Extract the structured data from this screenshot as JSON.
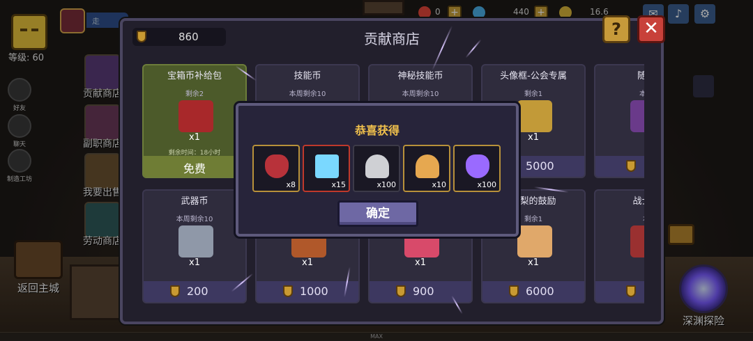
{
  "player": {
    "level_label": "等级: 60",
    "top_pill": "走"
  },
  "resources": [
    {
      "value": "0",
      "color": "#e2453a"
    },
    {
      "value": "440",
      "color": "#4ab0e8"
    },
    {
      "value": "16.6",
      "color": "#d8b43a"
    }
  ],
  "social": [
    {
      "label": "好友",
      "icon": "friends-icon"
    },
    {
      "label": "聊天",
      "icon": "chat-icon"
    },
    {
      "label": "制造工坊",
      "icon": "workshop-icon"
    }
  ],
  "side_tabs": [
    {
      "label": "贡献商店",
      "color": "#5a3b78"
    },
    {
      "label": "副职商店",
      "color": "#6b3a5a"
    },
    {
      "label": "我要出售",
      "color": "#6b5230"
    },
    {
      "label": "劳动商店",
      "color": "#2f5a5a"
    }
  ],
  "return_label": "返回主城",
  "abyss_label": "深渊探险",
  "bottom_label": "MAX",
  "shop": {
    "title": "贡献商店",
    "coin_value": "860",
    "help_label": "?",
    "close_label": "✕",
    "cards_row1": [
      {
        "name": "宝箱币补给包",
        "sub": "剩余2",
        "qty": "x1",
        "timer": "剩余时间：18小时",
        "price": "免费",
        "free": true,
        "item_color": "#a8282a"
      },
      {
        "name": "技能币",
        "sub": "本周剩余10",
        "qty": "",
        "timer": "",
        "price": "",
        "free": false,
        "item_color": "#4a4860"
      },
      {
        "name": "神秘技能币",
        "sub": "本周剩余10",
        "qty": "",
        "timer": "",
        "price": "",
        "free": false,
        "item_color": "#4a4860"
      },
      {
        "name": "头像框-公会专属",
        "sub": "剩余1",
        "qty": "x1",
        "timer": "",
        "price": "5000",
        "free": false,
        "item_color": "#c29a38"
      },
      {
        "name": "随机",
        "sub": "本周",
        "qty": "",
        "timer": "",
        "price": "",
        "free": false,
        "item_color": "#6a3a8a"
      }
    ],
    "cards_row2": [
      {
        "name": "武器币",
        "sub": "本周剩余10",
        "qty": "x1",
        "price": "200",
        "item_color": "#8f98a8"
      },
      {
        "name": "",
        "sub": "",
        "qty": "x1",
        "price": "1000",
        "item_color": "#b0582a"
      },
      {
        "name": "",
        "sub": "",
        "qty": "x1",
        "price": "900",
        "item_color": "#d84a6a"
      },
      {
        "name": "梨梨的鼓励",
        "sub": "剩余1",
        "qty": "x1",
        "price": "6000",
        "item_color": "#e0a86a"
      },
      {
        "name": "战士天",
        "sub": "本",
        "qty": "",
        "price": "",
        "item_color": "#9a3030"
      }
    ]
  },
  "popup": {
    "title": "恭喜获得",
    "confirm_label": "确定",
    "rewards": [
      {
        "count": "x8",
        "color": "#b8323a",
        "style": "gold",
        "icon": "red-crystal-icon"
      },
      {
        "count": "x15",
        "color": "#7ad8ff",
        "style": "rare",
        "icon": "blue-diamond-icon"
      },
      {
        "count": "x100",
        "color": "#cfd0d4",
        "style": "gray",
        "icon": "silver-powder-icon"
      },
      {
        "count": "x10",
        "color": "#e6a850",
        "style": "gold",
        "icon": "gold-powder-icon"
      },
      {
        "count": "x100",
        "color": "#9a6aff",
        "style": "gold",
        "icon": "purple-flame-icon"
      }
    ]
  }
}
